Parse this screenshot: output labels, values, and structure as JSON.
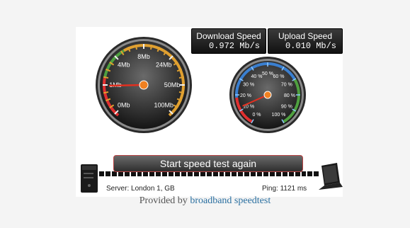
{
  "readouts": {
    "download_label": "Download Speed",
    "download_value": "0.972 Mb/s",
    "upload_label": "Upload Speed",
    "upload_value": "0.010 Mb/s"
  },
  "download_gauge": {
    "labels": [
      "0Mb",
      "1Mb",
      "4Mb",
      "8Mb",
      "24Mb",
      "50Mb",
      "100Mb"
    ],
    "needle_value_mbps": 0.972,
    "arc_colors": [
      "#e03030",
      "#e0a030",
      "#4fa040",
      "#3a7fd0"
    ]
  },
  "upload_gauge": {
    "labels": [
      "0 %",
      "10 %",
      "20 %",
      "30 %",
      "40 %",
      "50 %",
      "60 %",
      "70 %",
      "80 %",
      "90 %",
      "100 %"
    ],
    "needle_percent": 12
  },
  "button": {
    "label": "Start speed test again"
  },
  "server": "Server: London 1, GB",
  "ping": "Ping: 1121 ms",
  "footer": {
    "prefix": "Provided by ",
    "link": "broadband speedtest"
  },
  "icons": {
    "desktop": "desktop-tower-icon",
    "laptop": "laptop-icon"
  }
}
